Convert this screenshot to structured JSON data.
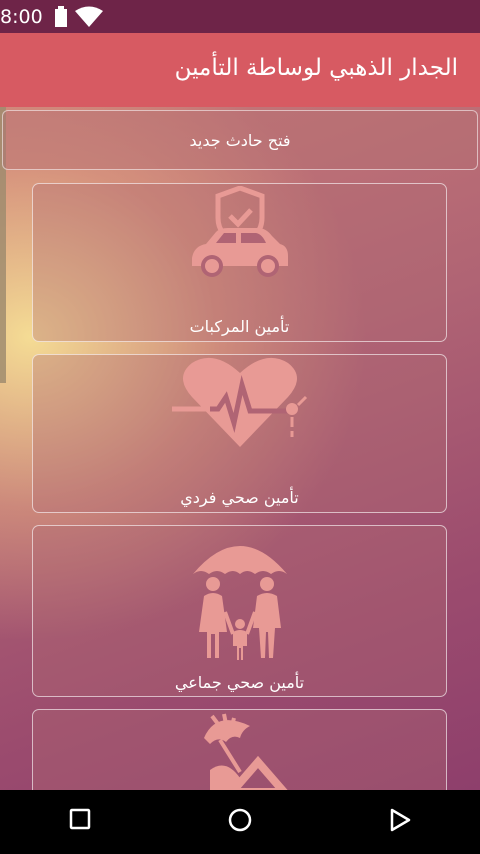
{
  "status_bar": {
    "time": "8:00",
    "icons": [
      "battery-icon",
      "wifi-icon"
    ]
  },
  "app_bar": {
    "title": "الجدار الذهبي لوساطة التأمين",
    "color": "#d75a62"
  },
  "main": {
    "open_accident_label": "فتح حادث جديد",
    "cards": [
      {
        "label": "تأمين المركبات",
        "icon": "car-shield-icon"
      },
      {
        "label": "تأمين صحي فردي",
        "icon": "heart-pulse-icon"
      },
      {
        "label": "تأمين صحي جماعي",
        "icon": "family-umbrella-icon"
      },
      {
        "label": "",
        "icon": "home-umbrella-icon"
      }
    ]
  },
  "nav_bar": {
    "icons": [
      "recents-square-icon",
      "home-circle-icon",
      "back-triangle-icon"
    ]
  },
  "colors": {
    "status_bar": "#6e2448",
    "icon_fill": "#e89a95"
  }
}
